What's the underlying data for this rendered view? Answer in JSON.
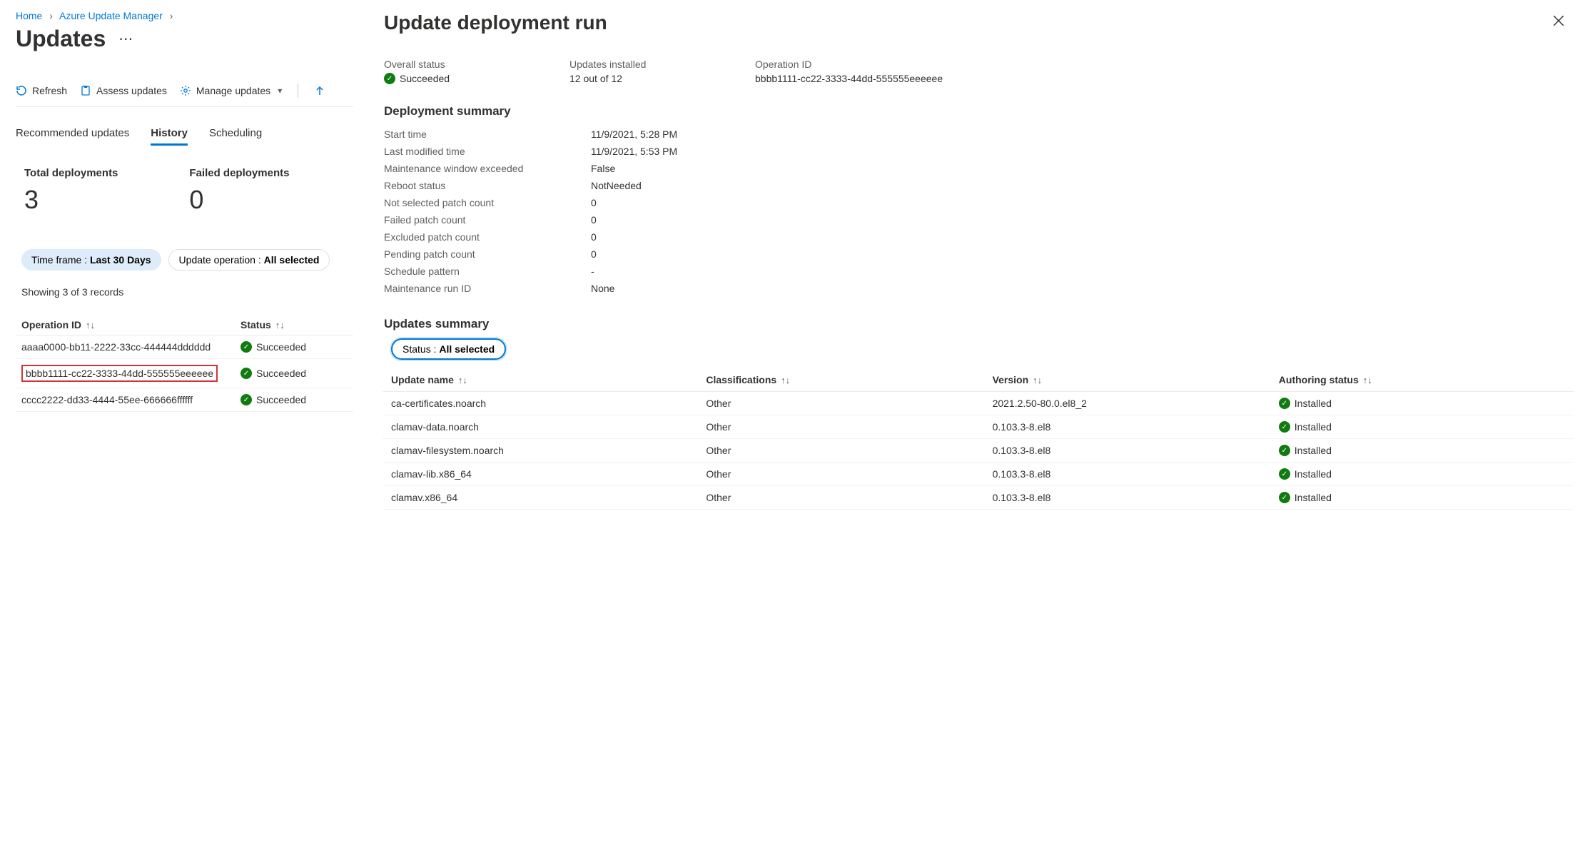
{
  "breadcrumb": [
    "Home",
    "Azure Update Manager"
  ],
  "page_title": "Updates",
  "toolbar": {
    "refresh": "Refresh",
    "assess": "Assess updates",
    "manage": "Manage updates"
  },
  "tabs": {
    "recommended": "Recommended updates",
    "history": "History",
    "scheduling": "Scheduling"
  },
  "stats": {
    "total_label": "Total deployments",
    "total_value": "3",
    "failed_label": "Failed deployments",
    "failed_value": "0"
  },
  "filters": {
    "timeframe_label": "Time frame : ",
    "timeframe_value": "Last 30 Days",
    "operation_label": "Update operation : ",
    "operation_value": "All selected"
  },
  "records_count": "Showing 3 of 3 records",
  "op_table": {
    "col_id": "Operation ID",
    "col_status": "Status",
    "rows": [
      {
        "id": "aaaa0000-bb11-2222-33cc-444444dddddd",
        "status": "Succeeded",
        "highlight": false
      },
      {
        "id": "bbbb1111-cc22-3333-44dd-555555eeeeee",
        "status": "Succeeded",
        "highlight": true
      },
      {
        "id": "cccc2222-dd33-4444-55ee-666666ffffff",
        "status": "Succeeded",
        "highlight": false
      }
    ]
  },
  "panel": {
    "title": "Update deployment run",
    "overall": {
      "status_label": "Overall status",
      "status_value": "Succeeded",
      "installed_label": "Updates installed",
      "installed_value": "12 out of 12",
      "opid_label": "Operation ID",
      "opid_value": "bbbb1111-cc22-3333-44dd-555555eeeeee"
    },
    "summary_title": "Deployment summary",
    "summary": [
      {
        "k": "Start time",
        "v": "11/9/2021, 5:28 PM"
      },
      {
        "k": "Last modified time",
        "v": "11/9/2021, 5:53 PM"
      },
      {
        "k": "Maintenance window exceeded",
        "v": "False"
      },
      {
        "k": "Reboot status",
        "v": "NotNeeded"
      },
      {
        "k": "Not selected patch count",
        "v": "0"
      },
      {
        "k": "Failed patch count",
        "v": "0"
      },
      {
        "k": "Excluded patch count",
        "v": "0"
      },
      {
        "k": "Pending patch count",
        "v": "0"
      },
      {
        "k": "Schedule pattern",
        "v": "-"
      },
      {
        "k": "Maintenance run ID",
        "v": "None"
      }
    ],
    "updates_title": "Updates summary",
    "updates_filter_label": "Status : ",
    "updates_filter_value": "All selected",
    "updates_cols": {
      "name": "Update name",
      "cls": "Classifications",
      "ver": "Version",
      "auth": "Authoring status"
    },
    "updates": [
      {
        "name": "ca-certificates.noarch",
        "cls": "Other",
        "ver": "2021.2.50-80.0.el8_2",
        "auth": "Installed"
      },
      {
        "name": "clamav-data.noarch",
        "cls": "Other",
        "ver": "0.103.3-8.el8",
        "auth": "Installed"
      },
      {
        "name": "clamav-filesystem.noarch",
        "cls": "Other",
        "ver": "0.103.3-8.el8",
        "auth": "Installed"
      },
      {
        "name": "clamav-lib.x86_64",
        "cls": "Other",
        "ver": "0.103.3-8.el8",
        "auth": "Installed"
      },
      {
        "name": "clamav.x86_64",
        "cls": "Other",
        "ver": "0.103.3-8.el8",
        "auth": "Installed"
      }
    ]
  }
}
